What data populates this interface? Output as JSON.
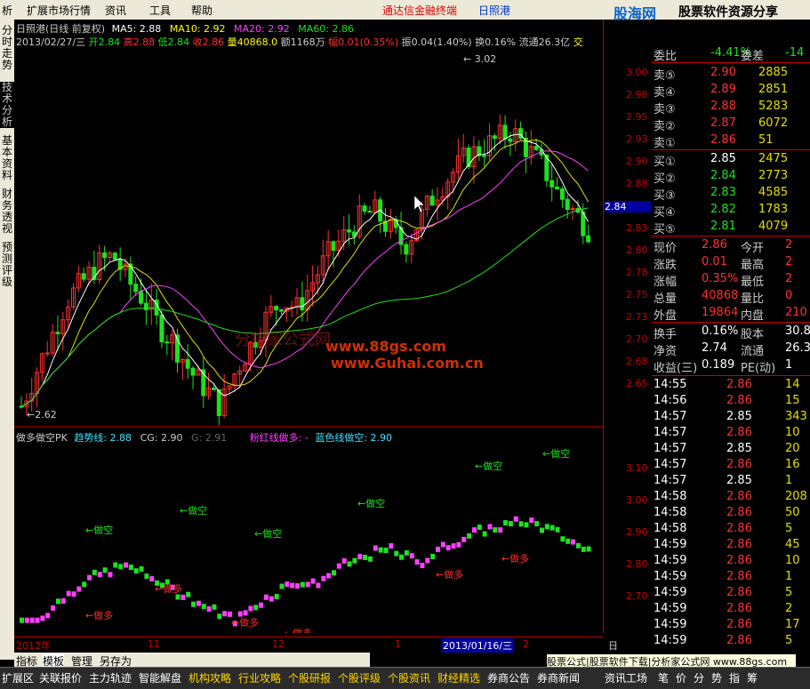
{
  "menu": {
    "items": [
      "析",
      "扩展市场行情",
      "资讯",
      "工具",
      "帮助"
    ],
    "center": "通达信金融终端",
    "stock": "日照港"
  },
  "brand": {
    "logo": "股海网",
    "tagline": "股票软件资源分享",
    "url": "www.Guhai.com.cn"
  },
  "left_tabs": [
    "分时走势",
    "技术分析",
    "基本资料",
    "财务透视",
    "预测评级"
  ],
  "info_line1": {
    "title": "日照港(日线 前复权)",
    "ma5": "MA5: 2.88",
    "ma10": "MA10: 2.92",
    "ma20": "MA20: 2.92",
    "ma60": "MA60: 2.86"
  },
  "info_line2": {
    "date": "2013/02/27/三",
    "open": "开2.84",
    "high": "高2.88",
    "low": "低2.84",
    "close": "收2.86",
    "vol": "量40868.0",
    "amount": "额1168万",
    "amp": "幅0.01(0.35%)",
    "swing": "振0.04(1.40%)",
    "turnover": "换0.16%",
    "float": "流通26.3亿",
    "tail": "交"
  },
  "indicator": {
    "name": "做多做空PK",
    "trend": "趋势线: 2.88",
    "cg": "CG: 2.90",
    "g": "G: 2.91",
    "pink": "粉红线做多: -",
    "blue": "蓝色线做空: 2.90"
  },
  "price_axis": [
    "3.00",
    "2.98",
    "2.95",
    "2.93",
    "2.90",
    "2.88",
    "2.85",
    "2.83",
    "2.80",
    "2.78",
    "2.75",
    "2.73",
    "2.70",
    "2.68",
    "2.65"
  ],
  "ind_axis": [
    "3.10",
    "3.00",
    "2.90",
    "2.80",
    "2.70"
  ],
  "current_price": "2.84",
  "high_mark": "3.02",
  "low_mark": "2.62",
  "watermark1": "分析家公式网",
  "watermark2": "www.88gs.com",
  "watermark3": "www.Guhai.com.cn",
  "annotations_short": "←做空",
  "annotations_long": "←做多",
  "time_axis": {
    "y2012": "2012年",
    "m11": "11",
    "m12": "12",
    "m1": "1",
    "date": "2013/01/16/三",
    "m2": "2",
    "label": "日线"
  },
  "quote": {
    "weibi": "委比",
    "weibi_val": "-4.41%",
    "weicha": "委差",
    "weicha_val": "-14",
    "sell": [
      {
        "l": "卖⑤",
        "p": "2.90",
        "v": "2885"
      },
      {
        "l": "卖④",
        "p": "2.89",
        "v": "2851"
      },
      {
        "l": "卖③",
        "p": "2.88",
        "v": "5283"
      },
      {
        "l": "卖②",
        "p": "2.87",
        "v": "6072"
      },
      {
        "l": "卖①",
        "p": "2.86",
        "v": "51"
      }
    ],
    "buy": [
      {
        "l": "买①",
        "p": "2.85",
        "v": "2475"
      },
      {
        "l": "买②",
        "p": "2.84",
        "v": "2773"
      },
      {
        "l": "买③",
        "p": "2.83",
        "v": "4585"
      },
      {
        "l": "买④",
        "p": "2.82",
        "v": "1783"
      },
      {
        "l": "买⑤",
        "p": "2.81",
        "v": "4079"
      }
    ],
    "stats": [
      {
        "a": "现价",
        "av": "2.86",
        "b": "今开",
        "bv": "2"
      },
      {
        "a": "涨跌",
        "av": "0.01",
        "b": "最高",
        "bv": "2"
      },
      {
        "a": "涨幅",
        "av": "0.35%",
        "b": "最低",
        "bv": "2"
      },
      {
        "a": "总量",
        "av": "40868",
        "b": "量比",
        "bv": "0"
      },
      {
        "a": "外盘",
        "av": "19864",
        "b": "内盘",
        "bv": "210"
      }
    ],
    "fin": [
      {
        "a": "换手",
        "av": "0.16%",
        "b": "股本",
        "bv": "30.8"
      },
      {
        "a": "净资",
        "av": "2.74",
        "b": "流通",
        "bv": "26.3"
      },
      {
        "a": "收益(三)",
        "av": "0.189",
        "b": "PE(动)",
        "bv": "1"
      }
    ],
    "ticks": [
      {
        "t": "14:55",
        "p": "2.86",
        "v": "14"
      },
      {
        "t": "14:56",
        "p": "2.86",
        "v": "15"
      },
      {
        "t": "14:57",
        "p": "2.85",
        "v": "343"
      },
      {
        "t": "14:57",
        "p": "2.86",
        "v": "10"
      },
      {
        "t": "14:57",
        "p": "2.85",
        "v": "20"
      },
      {
        "t": "14:57",
        "p": "2.86",
        "v": "16"
      },
      {
        "t": "14:57",
        "p": "2.85",
        "v": "1"
      },
      {
        "t": "14:58",
        "p": "2.86",
        "v": "208"
      },
      {
        "t": "14:58",
        "p": "2.86",
        "v": "50"
      },
      {
        "t": "14:58",
        "p": "2.86",
        "v": "5"
      },
      {
        "t": "14:59",
        "p": "2.86",
        "v": "45"
      },
      {
        "t": "14:59",
        "p": "2.86",
        "v": "10"
      },
      {
        "t": "14:59",
        "p": "2.86",
        "v": "1"
      },
      {
        "t": "14:59",
        "p": "2.86",
        "v": "5"
      },
      {
        "t": "14:59",
        "p": "2.86",
        "v": "2"
      },
      {
        "t": "14:59",
        "p": "2.86",
        "v": "17"
      },
      {
        "t": "14:59",
        "p": "2.86",
        "v": "5"
      }
    ]
  },
  "bottom_tabs": [
    "指标",
    "模板",
    "管理",
    "另存为"
  ],
  "ad_text": "股票公式|股票软件下载|分析家公式网 www.88gs.com",
  "func_bar": [
    "扩展区",
    "关联报价",
    "主力轨迹",
    "智能解盘",
    "机构攻略",
    "行业攻略",
    "个股研报",
    "个股评级",
    "个股资讯",
    "财经精选",
    "券商公告",
    "券商新闻",
    "资讯工场",
    "笔",
    "价",
    "分",
    "势",
    "指",
    "筹"
  ]
}
